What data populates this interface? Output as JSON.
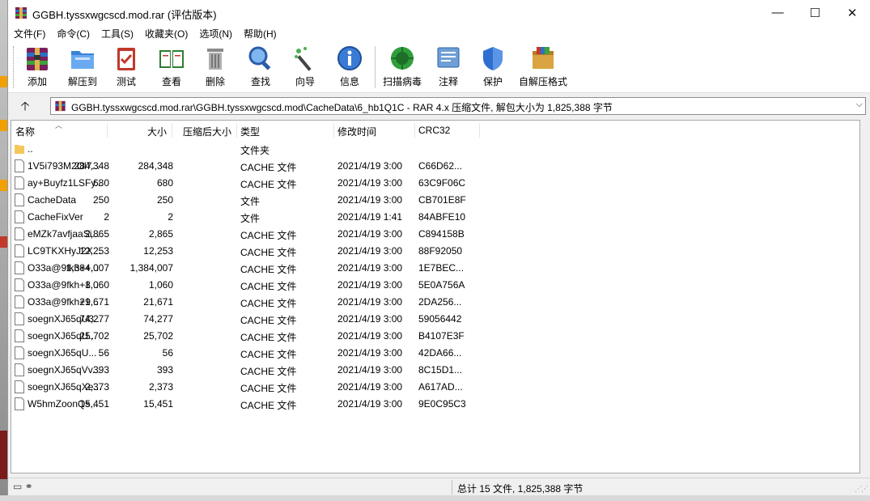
{
  "window": {
    "title": "GGBH.tyssxwgcscd.mod.rar (评估版本)",
    "controls": {
      "minimize": "—",
      "maximize": "☐",
      "close": "✕"
    }
  },
  "menu": [
    "文件(F)",
    "命令(C)",
    "工具(S)",
    "收藏夹(O)",
    "选项(N)",
    "帮助(H)"
  ],
  "toolbar": [
    {
      "id": "add",
      "label": "添加",
      "icon": "archive-books-icon"
    },
    {
      "id": "extract",
      "label": "解压到",
      "icon": "folder-extract-icon"
    },
    {
      "id": "test",
      "label": "测试",
      "icon": "clipboard-check-icon"
    },
    {
      "id": "view",
      "label": "查看",
      "icon": "open-book-icon"
    },
    {
      "id": "delete",
      "label": "删除",
      "icon": "trash-can-icon"
    },
    {
      "id": "find",
      "label": "查找",
      "icon": "magnifier-icon"
    },
    {
      "id": "wizard",
      "label": "向导",
      "icon": "magic-wand-icon"
    },
    {
      "id": "info",
      "label": "信息",
      "icon": "info-icon"
    },
    {
      "id": "virus",
      "label": "扫描病毒",
      "icon": "virus-scan-icon"
    },
    {
      "id": "comment",
      "label": "注释",
      "icon": "comment-icon"
    },
    {
      "id": "protect",
      "label": "保护",
      "icon": "shield-icon"
    },
    {
      "id": "sfx",
      "label": "自解压格式",
      "icon": "sfx-box-icon"
    }
  ],
  "address": {
    "up": "🡡",
    "path": "GGBH.tyssxwgcscd.mod.rar\\GGBH.tyssxwgcscd.mod\\CacheData\\6_hb1Q1C - RAR 4.x 压缩文件, 解包大小为 1,825,388 字节",
    "dropdown": "⌵"
  },
  "columns": {
    "name": "名称",
    "size": "大小",
    "packed": "压缩后大小",
    "type": "类型",
    "modified": "修改时间",
    "crc": "CRC32"
  },
  "files": [
    {
      "name": "..",
      "size": "",
      "packed": "",
      "type": "文件夹",
      "modified": "",
      "crc": "",
      "folder": true
    },
    {
      "name": "1V5i793M2Ol7...",
      "size": "284,348",
      "packed": "284,348",
      "type": "CACHE 文件",
      "modified": "2021/4/19 3:00",
      "crc": "C66D62..."
    },
    {
      "name": "ay+Buyfz1LSFy...",
      "size": "680",
      "packed": "680",
      "type": "CACHE 文件",
      "modified": "2021/4/19 3:00",
      "crc": "63C9F06C"
    },
    {
      "name": "CacheData",
      "size": "250",
      "packed": "250",
      "type": "文件",
      "modified": "2021/4/19 3:00",
      "crc": "CB701E8F"
    },
    {
      "name": "CacheFixVer",
      "size": "2",
      "packed": "2",
      "type": "文件",
      "modified": "2021/4/19 1:41",
      "crc": "84ABFE10"
    },
    {
      "name": "eMZk7avfjaaSi...",
      "size": "2,865",
      "packed": "2,865",
      "type": "CACHE 文件",
      "modified": "2021/4/19 3:00",
      "crc": "C894158B"
    },
    {
      "name": "LC9TKXHyJ2X...",
      "size": "12,253",
      "packed": "12,253",
      "type": "CACHE 文件",
      "modified": "2021/4/19 3:00",
      "crc": "88F92050"
    },
    {
      "name": "O33a@9fkh++...",
      "size": "1,384,007",
      "packed": "1,384,007",
      "type": "CACHE 文件",
      "modified": "2021/4/19 3:00",
      "crc": "1E7BEC..."
    },
    {
      "name": "O33a@9fkh+8...",
      "size": "1,060",
      "packed": "1,060",
      "type": "CACHE 文件",
      "modified": "2021/4/19 3:00",
      "crc": "5E0A756A"
    },
    {
      "name": "O33a@9fkh+9...",
      "size": "21,671",
      "packed": "21,671",
      "type": "CACHE 文件",
      "modified": "2021/4/19 3:00",
      "crc": "2DA256..."
    },
    {
      "name": "soegnXJ65qU3...",
      "size": "74,277",
      "packed": "74,277",
      "type": "CACHE 文件",
      "modified": "2021/4/19 3:00",
      "crc": "59056442"
    },
    {
      "name": "soegnXJ65qU...",
      "size": "25,702",
      "packed": "25,702",
      "type": "CACHE 文件",
      "modified": "2021/4/19 3:00",
      "crc": "B4107E3F"
    },
    {
      "name": "soegnXJ65qU...",
      "size": "56",
      "packed": "56",
      "type": "CACHE 文件",
      "modified": "2021/4/19 3:00",
      "crc": "42DA66..."
    },
    {
      "name": "soegnXJ65qVv...",
      "size": "393",
      "packed": "393",
      "type": "CACHE 文件",
      "modified": "2021/4/19 3:00",
      "crc": "8C15D1..."
    },
    {
      "name": "soegnXJ65qXe...",
      "size": "2,373",
      "packed": "2,373",
      "type": "CACHE 文件",
      "modified": "2021/4/19 3:00",
      "crc": "A617AD..."
    },
    {
      "name": "W5hmZoonQs...",
      "size": "15,451",
      "packed": "15,451",
      "type": "CACHE 文件",
      "modified": "2021/4/19 3:00",
      "crc": "9E0C95C3"
    }
  ],
  "status": {
    "summary": "总计 15 文件, 1,825,388 字节",
    "icons": "▭ ⚭"
  },
  "colors": {
    "accent": "#0078d7",
    "folder": "#f5c75b",
    "winrar_red": "#a4262c"
  }
}
